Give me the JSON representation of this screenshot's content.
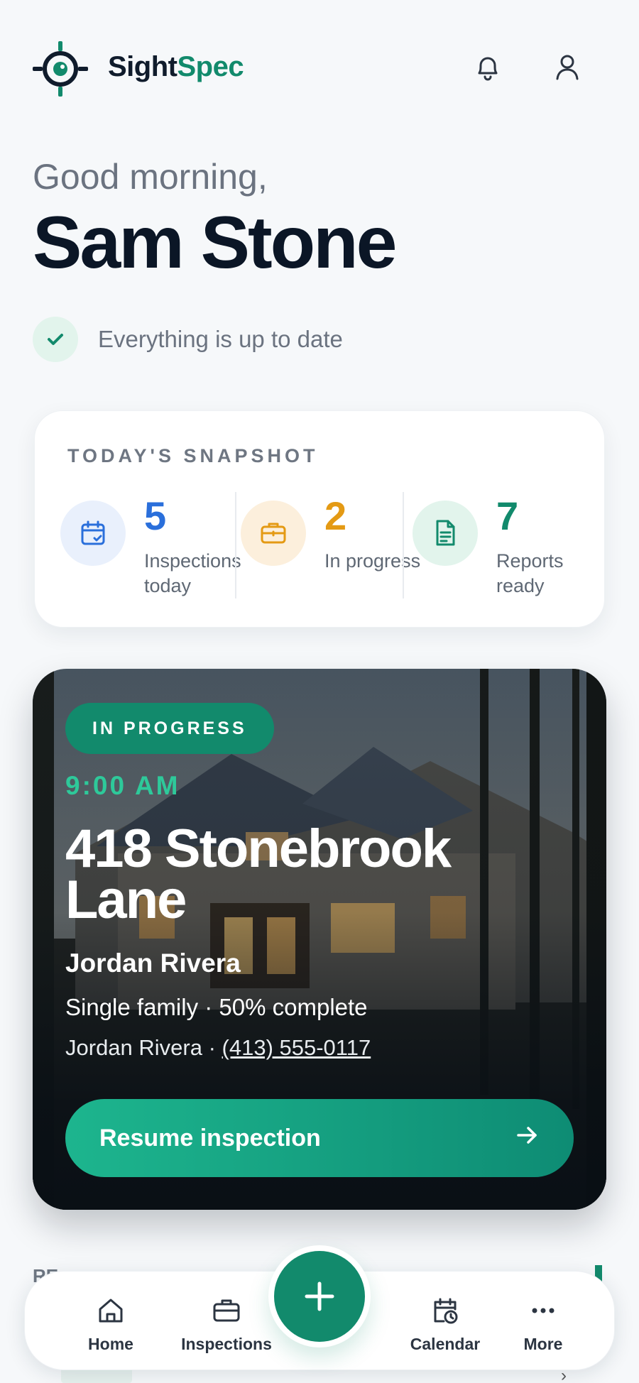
{
  "header": {
    "brand_part1": "Sight",
    "brand_part2": "Spec",
    "icons": [
      "target-logo-icon",
      "bell-icon",
      "user-icon"
    ]
  },
  "greeting": {
    "salutation": "Good morning,",
    "name": "Sam Stone",
    "status": "Everything is up to date"
  },
  "snapshot": {
    "title": "TODAY'S SNAPSHOT",
    "stats": [
      {
        "value": "5",
        "label": "Inspections today",
        "color": "#2a6fdb",
        "bg": "#e9f0fc",
        "icon": "calendar-check-icon"
      },
      {
        "value": "2",
        "label": "In progress",
        "color": "#e49a14",
        "bg": "#fcefdc",
        "icon": "briefcase-icon"
      },
      {
        "value": "7",
        "label": "Reports ready",
        "color": "#128a6c",
        "bg": "#e2f4ec",
        "icon": "document-icon"
      }
    ]
  },
  "current_inspection": {
    "badge": "IN PROGRESS",
    "time": "9:00 AM",
    "address": "418 Stonebrook Lane",
    "client": "Jordan Rivera",
    "meta": "Single family · 50% complete",
    "contact_name": "Jordan Rivera · ",
    "contact_phone": "(413) 555-0117",
    "progress_percent": 50,
    "action_label": "Resume inspection"
  },
  "section_below": {
    "title_fragment": "RE"
  },
  "bottom_nav": {
    "items": [
      {
        "label": "Home",
        "icon": "home-icon"
      },
      {
        "label": "Inspections",
        "icon": "briefcase-icon"
      },
      {
        "label": "Calendar",
        "icon": "calendar-clock-icon"
      },
      {
        "label": "More",
        "icon": "more-dots-icon"
      }
    ],
    "fab_icon": "plus-icon"
  },
  "colors": {
    "accent": "#128a6c",
    "accent_light": "#2ec99a",
    "text_dark": "#0b1626",
    "text_muted": "#6b7380",
    "background": "#f6f8fa"
  }
}
